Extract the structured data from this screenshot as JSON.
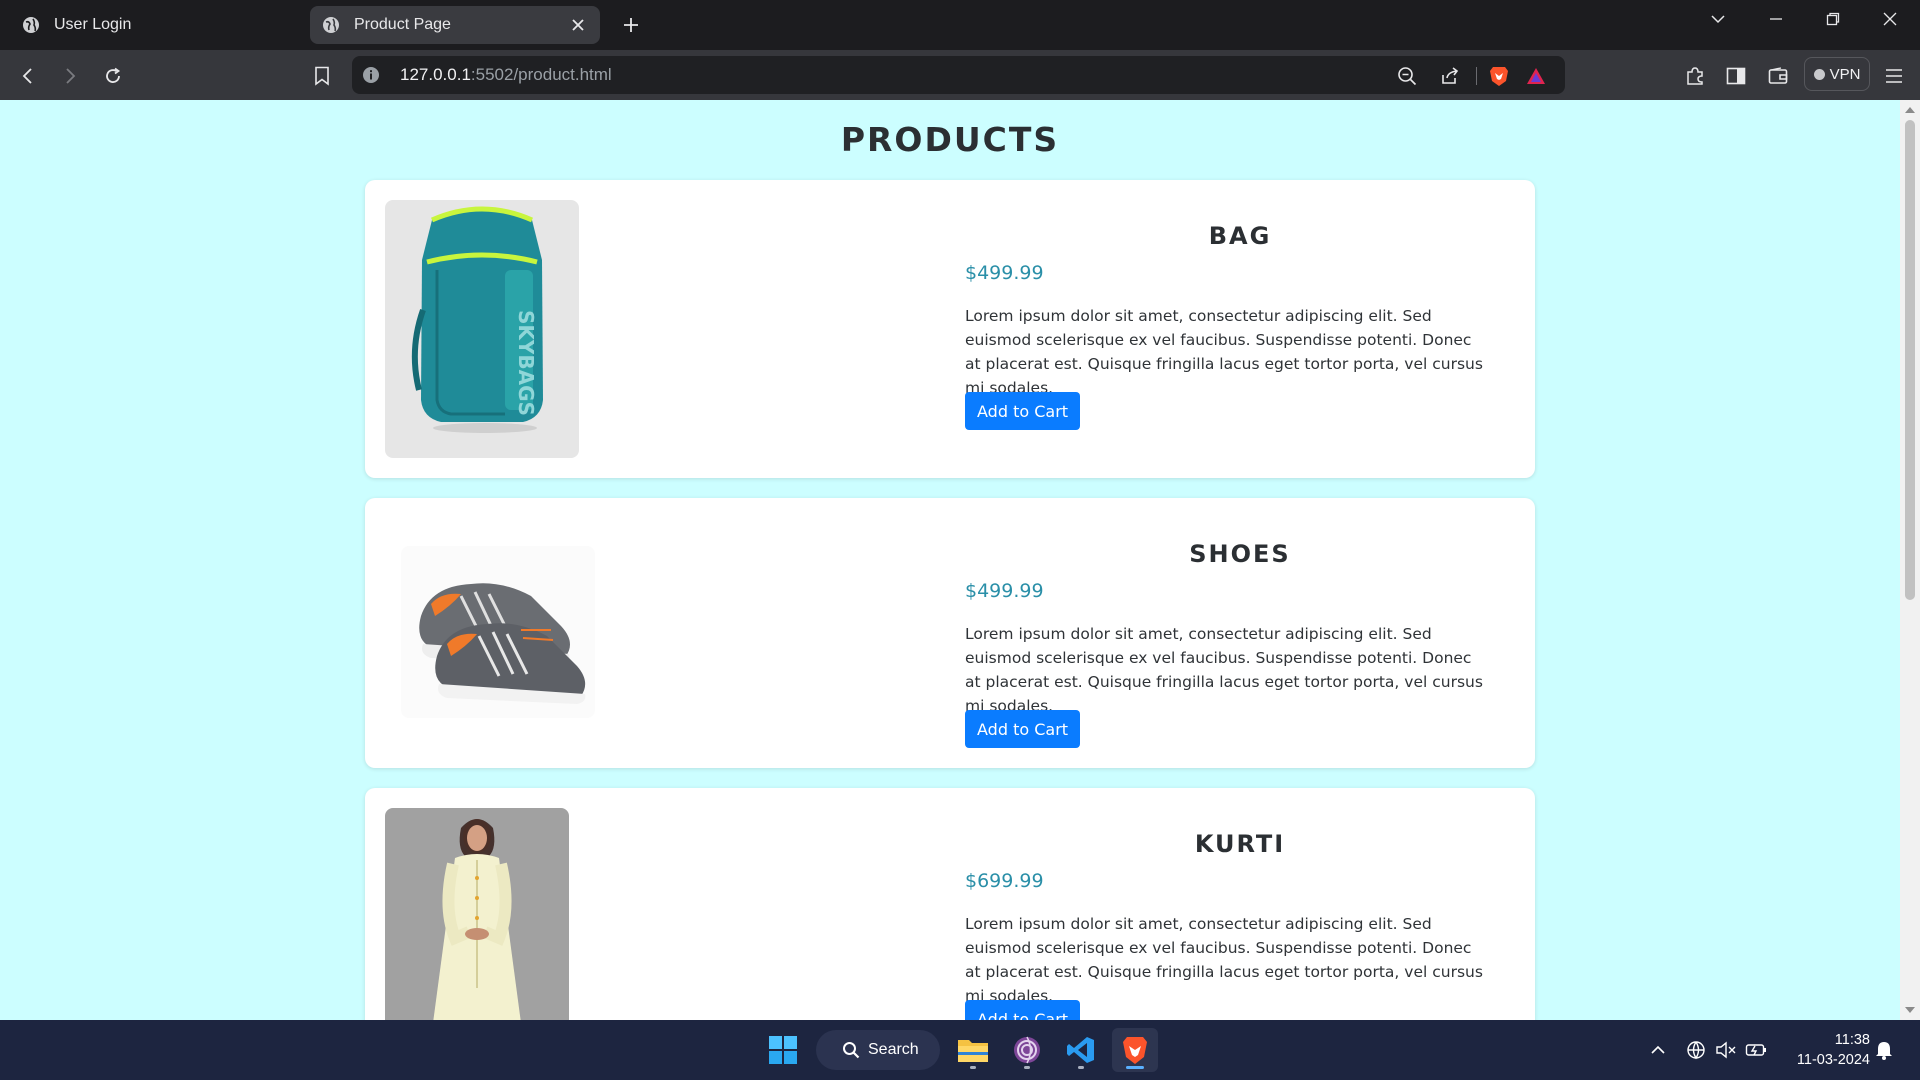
{
  "browser": {
    "tabs": [
      {
        "title": "User Login",
        "active": false
      },
      {
        "title": "Product Page",
        "active": true
      }
    ],
    "url_host": "127.0.0.1",
    "url_rest": ":5502/product.html",
    "vpn_label": "VPN"
  },
  "page": {
    "title": "PRODUCTS",
    "products": [
      {
        "name": "BAG",
        "price": "$499.99",
        "description": "Lorem ipsum dolor sit amet, consectetur adipiscing elit. Sed euismod scelerisque ex vel faucibus. Suspendisse potenti. Donec at placerat est. Quisque fringilla lacus eget tortor porta, vel cursus mi sodales.",
        "button": "Add to Cart"
      },
      {
        "name": "SHOES",
        "price": "$499.99",
        "description": "Lorem ipsum dolor sit amet, consectetur adipiscing elit. Sed euismod scelerisque ex vel faucibus. Suspendisse potenti. Donec at placerat est. Quisque fringilla lacus eget tortor porta, vel cursus mi sodales.",
        "button": "Add to Cart"
      },
      {
        "name": "KURTI",
        "price": "$699.99",
        "description": "Lorem ipsum dolor sit amet, consectetur adipiscing elit. Sed euismod scelerisque ex vel faucibus. Suspendisse potenti. Donec at placerat est. Quisque fringilla lacus eget tortor porta, vel cursus mi sodales.",
        "button": "Add to Cart"
      }
    ]
  },
  "taskbar": {
    "search_label": "Search",
    "time": "11:38",
    "date": "11-03-2024",
    "apps": [
      "start-icon",
      "file-explorer-icon",
      "tor-browser-icon",
      "vscode-icon",
      "brave-icon"
    ]
  },
  "colors": {
    "page_background": "#ccfeff",
    "button_blue": "#0a7cff",
    "price_teal": "#2a8fa8",
    "card_background": "#ffffff"
  }
}
